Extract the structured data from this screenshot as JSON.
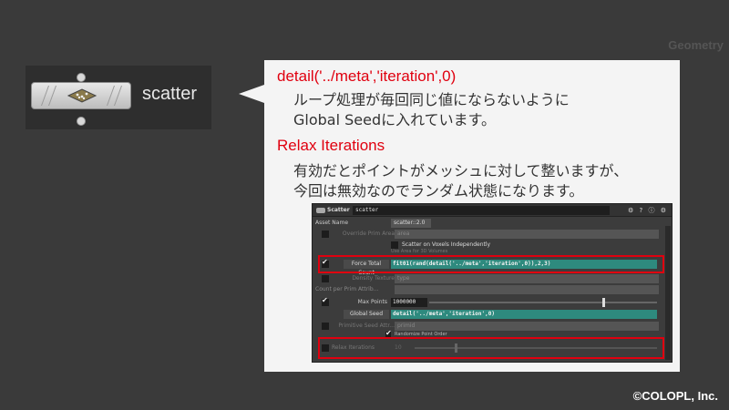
{
  "context": "Geometry",
  "node": {
    "label": "scatter"
  },
  "callout": {
    "heading1": "detail('../meta','iteration',0)",
    "text1a": "ループ処理が毎回同じ値にならないように",
    "text1b": "Global Seedに入れています。",
    "heading2": "Relax Iterations",
    "text2a": "有効だとポイントがメッシュに対して整いますが、",
    "text2b": "今回は無効なのでランダム状態になります。"
  },
  "panel": {
    "node_type": "Scatter",
    "node_name": "scatter",
    "tool_icons": "⚙ ? ⓘ ⚙",
    "asset_name_label": "Asset Name",
    "asset_name_value": "scatter::2.0",
    "override_prim_area": "Override Prim Area",
    "override_prim_area_value": "area",
    "scatter_on_voxels": "Scatter on Voxels Independently",
    "use_area_label": "Use Area for 3D Volumes",
    "force_total_count": "Force Total Count",
    "force_total_count_expr": "fit01(rand(detail('../meta','iteration',0)),2,3)",
    "density_texture": "Density Texture",
    "density_texture_value": "type",
    "count_per_prim": "Count per Prim Attrib...",
    "count_per_prim_value": "",
    "max_points": "Max Points",
    "max_points_value": "1000000",
    "global_seed": "Global Seed",
    "global_seed_expr": "detail('../meta','iteration',0)",
    "primitive_seed": "Primitive Seed Attr...",
    "primitive_seed_value": "primid",
    "randomize_point_order": "Randomize Point Order",
    "relax_iterations": "Relax Iterations",
    "relax_iterations_value": "10"
  },
  "copyright": "©COLOPL, Inc."
}
